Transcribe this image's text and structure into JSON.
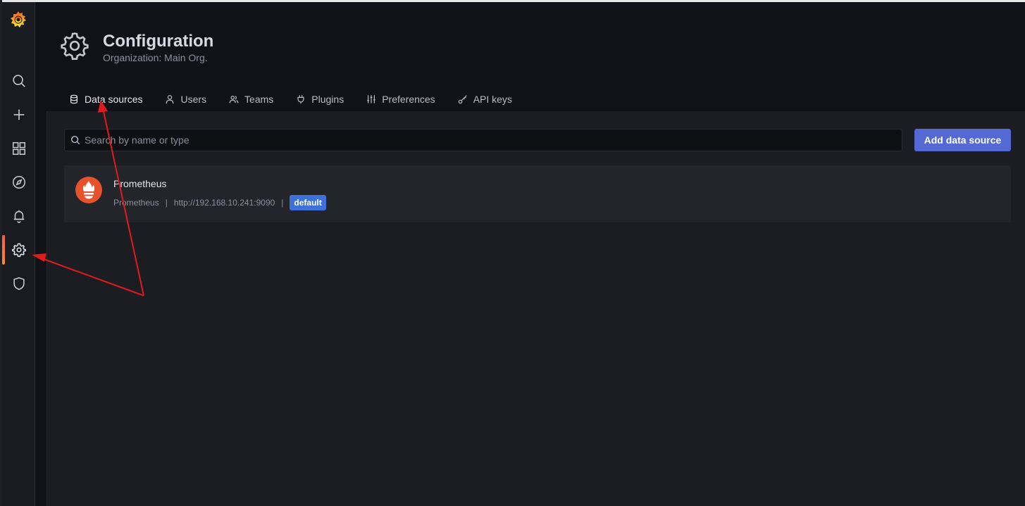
{
  "header": {
    "title": "Configuration",
    "subtitle": "Organization: Main Org."
  },
  "tabs": [
    {
      "label": "Data sources",
      "icon": "database-icon",
      "active": true
    },
    {
      "label": "Users",
      "icon": "user-icon",
      "active": false
    },
    {
      "label": "Teams",
      "icon": "users-icon",
      "active": false
    },
    {
      "label": "Plugins",
      "icon": "plug-icon",
      "active": false
    },
    {
      "label": "Preferences",
      "icon": "sliders-icon",
      "active": false
    },
    {
      "label": "API keys",
      "icon": "key-icon",
      "active": false
    }
  ],
  "sidebar": {
    "items": [
      {
        "icon": "search-icon"
      },
      {
        "icon": "plus-icon"
      },
      {
        "icon": "dashboards-icon"
      },
      {
        "icon": "compass-icon"
      },
      {
        "icon": "bell-icon"
      },
      {
        "icon": "gear-icon",
        "active": true
      },
      {
        "icon": "shield-icon"
      }
    ]
  },
  "search": {
    "placeholder": "Search by name or type"
  },
  "add_button": {
    "label": "Add data source"
  },
  "datasource": {
    "name": "Prometheus",
    "type": "Prometheus",
    "url": "http://192.168.10.241:9090",
    "separator": "|",
    "badge": "default"
  },
  "colors": {
    "accent": "#ff8833",
    "primary_button": "#5469d4",
    "badge": "#3d71d9",
    "annotation_arrow": "#e01b1b"
  }
}
